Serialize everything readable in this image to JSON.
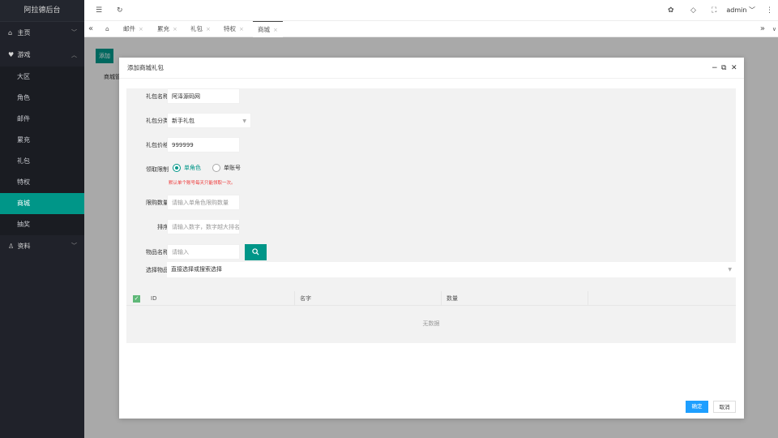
{
  "sidebar": {
    "brand": "阿拉德后台",
    "groups": [
      {
        "label": "主页"
      },
      {
        "label": "游戏"
      },
      {
        "label": "资料"
      }
    ],
    "items": [
      {
        "label": "大区"
      },
      {
        "label": "角色"
      },
      {
        "label": "邮件"
      },
      {
        "label": "累充"
      },
      {
        "label": "礼包"
      },
      {
        "label": "特权"
      },
      {
        "label": "商城"
      },
      {
        "label": "抽奖"
      }
    ]
  },
  "header": {
    "user": "admin"
  },
  "tabs": [
    {
      "label": "邮件"
    },
    {
      "label": "累充"
    },
    {
      "label": "礼包"
    },
    {
      "label": "特权"
    },
    {
      "label": "商城"
    }
  ],
  "content": {
    "add_label": "添加",
    "bg_tab": "商城管"
  },
  "modal": {
    "title": "添加商城礼包",
    "fields": {
      "name_label": "礼包名称",
      "name_value": "阿泽源码网",
      "category_label": "礼包分类",
      "category_value": "新手礼包",
      "price_label": "礼包价格",
      "price_value": "999999",
      "limit_label": "领取限制",
      "radio_1": "单角色",
      "radio_2": "单账号",
      "limit_hint": "默认单个账号每天只能领取一次。",
      "quota_label": "限购数量",
      "quota_placeholder": "请输入单角色限购数量",
      "sort_label": "排序",
      "sort_placeholder": "请输入数字，数字越大排名越",
      "item_name_label": "物品名称",
      "item_name_placeholder": "请输入",
      "item_select_label": "选择物品",
      "item_select_value": "直接选择或搜索选择"
    },
    "table": {
      "columns": [
        "ID",
        "名字",
        "数量"
      ],
      "empty": "无数据"
    },
    "ok_label": "确定",
    "cancel_label": "取消"
  }
}
